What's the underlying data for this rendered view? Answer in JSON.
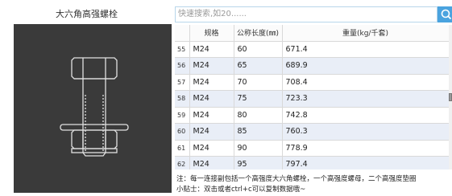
{
  "product": {
    "title": "大六角高强螺栓"
  },
  "search": {
    "placeholder": "快速搜索,如20......"
  },
  "table": {
    "headers": {
      "index": "",
      "spec": "规格",
      "length": "公称长度(㎜)",
      "weight": "重量(kg/千套)"
    },
    "rows": [
      {
        "index": "55",
        "spec": "M24",
        "length": "60",
        "weight": "671.4"
      },
      {
        "index": "56",
        "spec": "M24",
        "length": "65",
        "weight": "689.9"
      },
      {
        "index": "57",
        "spec": "M24",
        "length": "70",
        "weight": "708.4"
      },
      {
        "index": "58",
        "spec": "M24",
        "length": "75",
        "weight": "723.3"
      },
      {
        "index": "59",
        "spec": "M24",
        "length": "80",
        "weight": "742.8"
      },
      {
        "index": "60",
        "spec": "M24",
        "length": "85",
        "weight": "760.3"
      },
      {
        "index": "61",
        "spec": "M24",
        "length": "90",
        "weight": "778.9"
      },
      {
        "index": "62",
        "spec": "M24",
        "length": "95",
        "weight": "797.4"
      }
    ]
  },
  "footer": {
    "note": "注：每一连接副包括一个高强度大六角螺栓，一个高强度螺母，二个高强度垫圈",
    "tip": "小贴士：双击或者ctrl+c可以复制数据哦~"
  },
  "colors": {
    "accent": "#4aa3df",
    "row_alt": "#e9eef7",
    "illustration_bg": "#3a3a3a"
  }
}
